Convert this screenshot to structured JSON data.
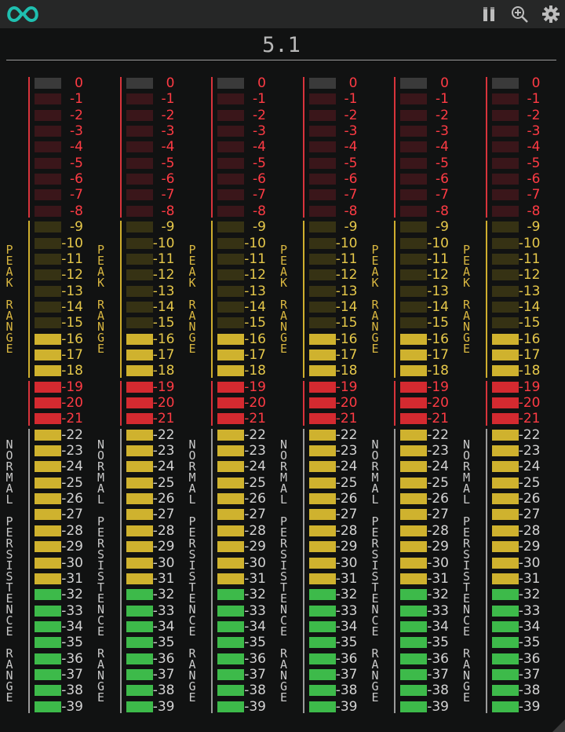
{
  "header": {
    "logo_icon": "infinity-logo-icon",
    "pause_icon": "pause-icon",
    "zoom_icon": "zoom-in-icon",
    "settings_icon": "gear-icon"
  },
  "title": "5.1",
  "meters": {
    "channel_count": 6,
    "labels": [
      "0",
      "-1",
      "-2",
      "-3",
      "-4",
      "-5",
      "-6",
      "-7",
      "-8",
      "-9",
      "-10",
      "-11",
      "-12",
      "-13",
      "-14",
      "-15",
      "-16",
      "-17",
      "-18",
      "-19",
      "-20",
      "-21",
      "-22",
      "-23",
      "-24",
      "-25",
      "-26",
      "-27",
      "-28",
      "-29",
      "-30",
      "-31",
      "-32",
      "-33",
      "-34",
      "-35",
      "-36",
      "-37",
      "-38",
      "-39"
    ],
    "zones": [
      {
        "name": "peak-over",
        "from": 0,
        "to": 8,
        "color": "#e0323a",
        "lit_color": "#d42a30",
        "dim_color": "#3a161a",
        "line_color": "#d8343c"
      },
      {
        "name": "peak-range",
        "from": 9,
        "to": 18,
        "color": "#d0b030",
        "lit_color": "#cfb22e",
        "dim_color": "#363214",
        "line_color": "#cfae2e",
        "side_text": "PEAK RANGE",
        "side_color": "#d8b640"
      },
      {
        "name": "reference",
        "from": 19,
        "to": 21,
        "color": "#e0323a",
        "lit_color": "#d42a30",
        "dim_color": "#3a161a",
        "line_color": "#d8343c"
      },
      {
        "name": "normal-persistence",
        "from": 22,
        "to": 39,
        "color": "#c8c8c8",
        "lit_color": "#cfb22e",
        "green_color": "#3dba4a",
        "dim_color": "#222",
        "line_color": "#9a9a9a",
        "side_text": "NORMAL PERSISTENCE RANGE",
        "side_color": "#c8c8c8"
      }
    ],
    "top_segment_color": "#3a3a3a",
    "lit_from_index": 16,
    "green_from_index": 32,
    "label_color_red": "#ff3b44",
    "label_color_yellow": "#e6c84a",
    "label_color_white": "#d2d2d2"
  }
}
